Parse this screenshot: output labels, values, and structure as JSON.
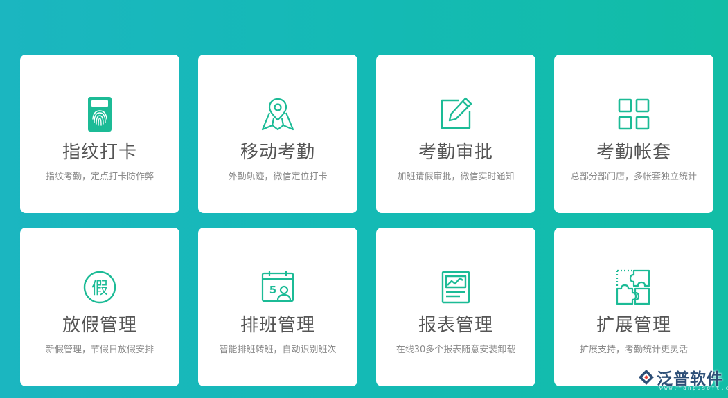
{
  "theme": {
    "accent": "#1cbb96",
    "card_bg": "#ffffff"
  },
  "cards": [
    {
      "icon": "fingerprint-card-icon",
      "title": "指纹打卡",
      "desc": "指纹考勤，定点打卡防作弊"
    },
    {
      "icon": "map-pin-icon",
      "title": "移动考勤",
      "desc": "外勤轨迹，微信定位打卡"
    },
    {
      "icon": "edit-square-icon",
      "title": "考勤审批",
      "desc": "加班请假审批，微信实时通知"
    },
    {
      "icon": "grid-icon",
      "title": "考勤帐套",
      "desc": "总部分部门店，多帐套独立统计"
    },
    {
      "icon": "leave-circle-icon",
      "title": "放假管理",
      "desc": "新假管理，节假日放假安排"
    },
    {
      "icon": "calendar-user-icon",
      "title": "排班管理",
      "desc": "智能排班转班，自动识别班次"
    },
    {
      "icon": "chart-report-icon",
      "title": "报表管理",
      "desc": "在线30多个报表随意安装卸载"
    },
    {
      "icon": "puzzle-icon",
      "title": "扩展管理",
      "desc": "扩展支持，考勤统计更灵活"
    }
  ],
  "icon_text": {
    "leave": "假",
    "schedule": "5"
  },
  "logo": {
    "name": "泛普软件",
    "url": "www.fanpusoft.com"
  }
}
